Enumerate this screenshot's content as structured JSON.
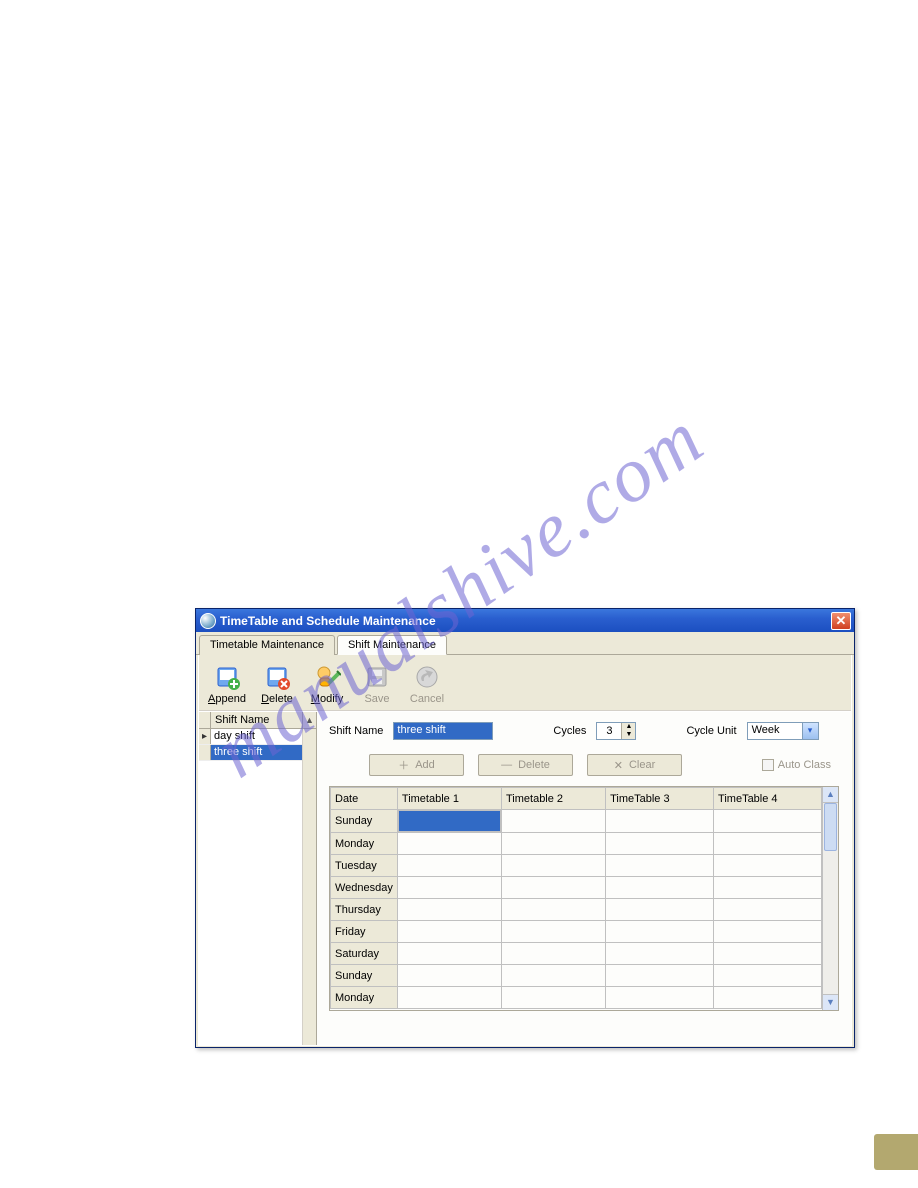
{
  "watermark": "manualshive.com",
  "window": {
    "title": "TimeTable and Schedule Maintenance",
    "tabs": [
      {
        "label": "Timetable Maintenance",
        "active": false
      },
      {
        "label": "Shift Maintenance",
        "active": true
      }
    ]
  },
  "toolbar": [
    {
      "id": "append",
      "label": "Append",
      "hotkey": "A",
      "enabled": true
    },
    {
      "id": "delete",
      "label": "Delete",
      "hotkey": "D",
      "enabled": true
    },
    {
      "id": "modify",
      "label": "Modify",
      "hotkey": "M",
      "enabled": true
    },
    {
      "id": "save",
      "label": "Save",
      "hotkey": "",
      "enabled": false
    },
    {
      "id": "cancel",
      "label": "Cancel",
      "hotkey": "",
      "enabled": false
    }
  ],
  "sidebar": {
    "header": "Shift Name",
    "items": [
      {
        "label": "day shift",
        "current": true,
        "selected": false
      },
      {
        "label": "three shift",
        "current": false,
        "selected": true
      }
    ]
  },
  "form": {
    "shift_name_label": "Shift Name",
    "shift_name_value": "three shift",
    "cycles_label": "Cycles",
    "cycles_value": "3",
    "cycle_unit_label": "Cycle Unit",
    "cycle_unit_value": "Week"
  },
  "buttons": {
    "add": "Add",
    "delete": "Delete",
    "clear": "Clear",
    "auto_class": "Auto Class"
  },
  "grid": {
    "columns": [
      "Date",
      "Timetable 1",
      "Timetable 2",
      "TimeTable 3",
      "TimeTable 4"
    ],
    "rows": [
      {
        "label": "Sunday",
        "selected": true
      },
      {
        "label": "Monday",
        "selected": false
      },
      {
        "label": "Tuesday",
        "selected": false
      },
      {
        "label": "Wednesday",
        "selected": false
      },
      {
        "label": "Thursday",
        "selected": false
      },
      {
        "label": "Friday",
        "selected": false
      },
      {
        "label": "Saturday",
        "selected": false
      },
      {
        "label": "Sunday",
        "selected": false
      },
      {
        "label": "Monday",
        "selected": false
      }
    ]
  }
}
